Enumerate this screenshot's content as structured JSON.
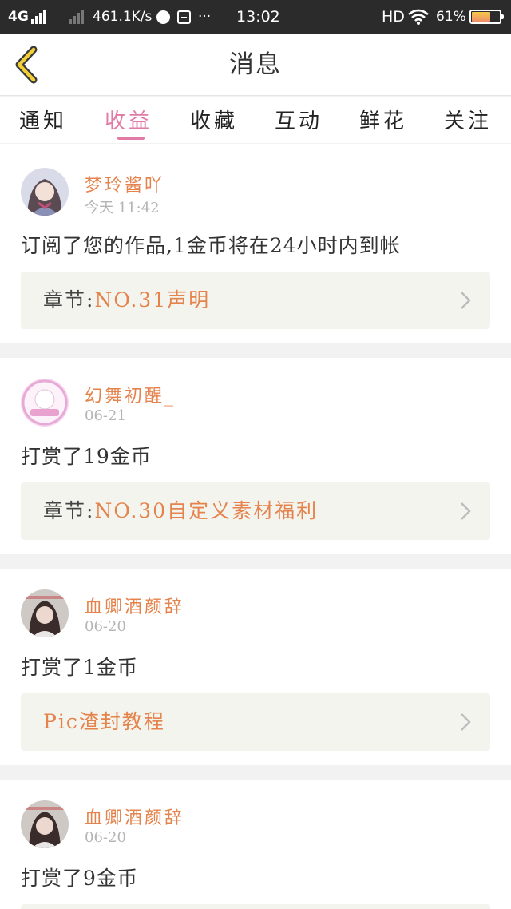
{
  "status_bar": {
    "network": "4G",
    "speed": "461.1K/s",
    "dots": "···",
    "time": "13:02",
    "hd": "HD",
    "battery": "61%"
  },
  "header": {
    "title": "消息",
    "back_icon": "chevron-left-icon"
  },
  "tabs": [
    {
      "label": "通知",
      "active": false
    },
    {
      "label": "收益",
      "active": true
    },
    {
      "label": "收藏",
      "active": false
    },
    {
      "label": "互动",
      "active": false
    },
    {
      "label": "鲜花",
      "active": false
    },
    {
      "label": "关注",
      "active": false
    }
  ],
  "colors": {
    "accent": "#e27aa6",
    "name": "#e5834c",
    "ref_bg": "#f4f4ee"
  },
  "messages": [
    {
      "name": "梦玲酱吖",
      "time": "今天 11:42",
      "text": "订阅了您的作品,1金币将在24小时内到帐",
      "ref_prefix": "章节:",
      "ref_text": "NO.31声明"
    },
    {
      "name": "幻舞初醒_",
      "time": "06-21",
      "text": "打赏了19金币",
      "ref_prefix": "章节:",
      "ref_text": "NO.30自定义素材福利"
    },
    {
      "name": "血卿酒颜辞",
      "time": "06-20",
      "text": "打赏了1金币",
      "ref_prefix": "",
      "ref_text": "Pic渣封教程"
    },
    {
      "name": "血卿酒颜辞",
      "time": "06-20",
      "text": "打赏了9金币",
      "ref_prefix": "",
      "ref_text": ""
    }
  ]
}
